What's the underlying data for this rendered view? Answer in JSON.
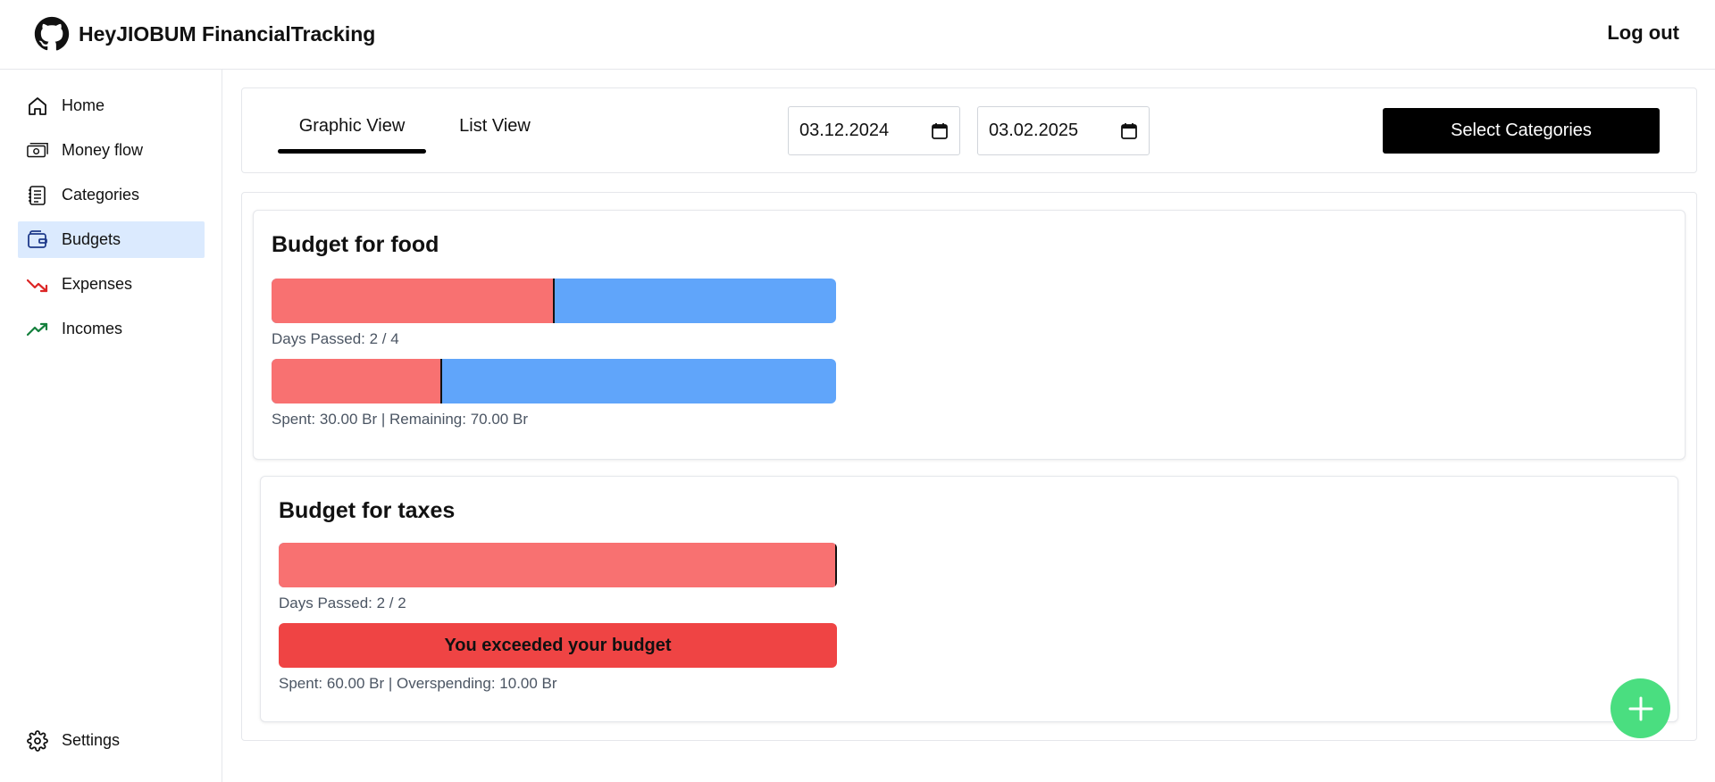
{
  "app": {
    "title": "HeyJIOBUM FinancialTracking",
    "logout_label": "Log out"
  },
  "sidebar": {
    "items": [
      {
        "label": "Home",
        "icon": "home-icon"
      },
      {
        "label": "Money flow",
        "icon": "money-icon"
      },
      {
        "label": "Categories",
        "icon": "list-icon"
      },
      {
        "label": "Budgets",
        "icon": "wallet-icon",
        "active": true
      },
      {
        "label": "Expenses",
        "icon": "trending-down-icon"
      },
      {
        "label": "Incomes",
        "icon": "trending-up-icon"
      }
    ],
    "settings_label": "Settings"
  },
  "toolbar": {
    "tabs": [
      {
        "label": "Graphic View",
        "selected": true
      },
      {
        "label": "List View",
        "selected": false
      }
    ],
    "date_from": "03.12.2024",
    "date_to": "03.02.2025",
    "select_categories_label": "Select Categories"
  },
  "budgets": [
    {
      "title": "Budget for food",
      "days_fraction": 0.5,
      "days_caption": "Days Passed: 2 / 4",
      "spent_fraction": 0.3,
      "money_caption": "Spent: 30.00 Br | Remaining: 70.00 Br"
    },
    {
      "title": "Budget for taxes",
      "days_fraction": 1.0,
      "days_caption": "Days Passed: 2 / 2",
      "exceeded_label": "You exceeded your budget",
      "money_caption": "Spent: 60.00 Br | Overspending: 10.00 Br"
    }
  ],
  "colors": {
    "elapsed": "#f87171",
    "remaining": "#60a5fa",
    "exceeded": "#ef4444",
    "active_nav": "#dbeafe",
    "fab": "#4ade80"
  },
  "fab": {
    "icon": "plus-icon"
  }
}
